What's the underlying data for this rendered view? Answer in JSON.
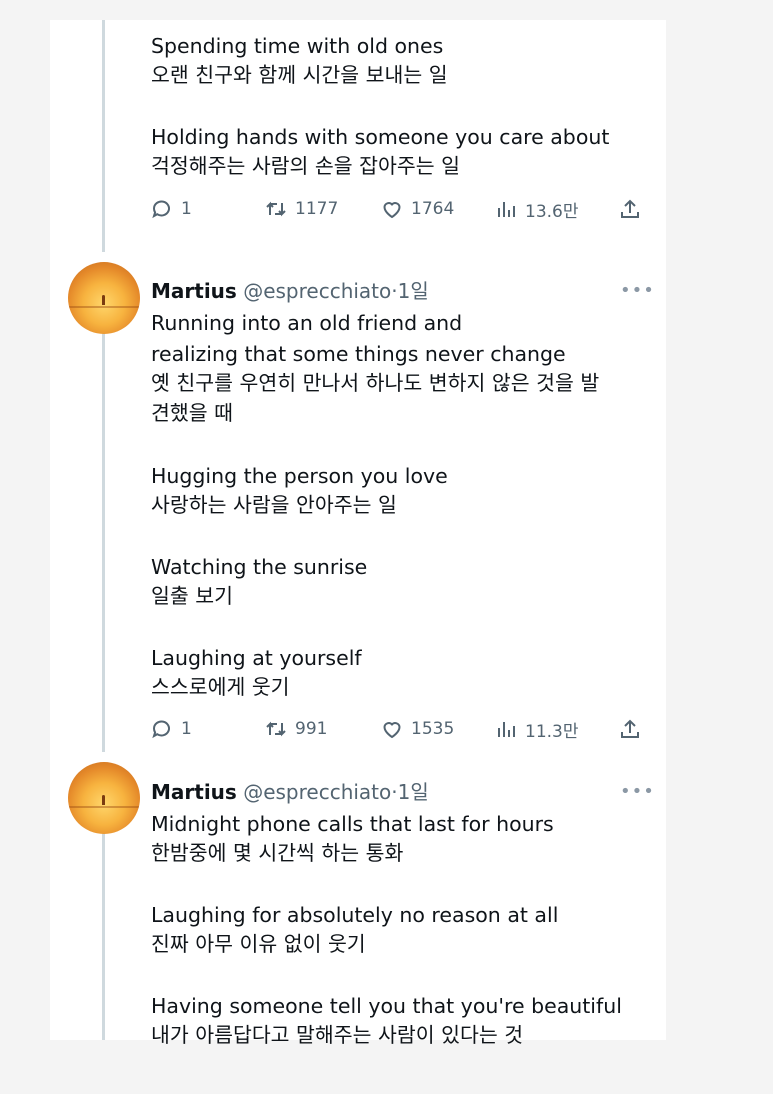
{
  "tweet0": {
    "lines": [
      "Spending time with old ones",
      "오랜 친구와 함께 시간을 보내는 일",
      "Holding hands with someone you care about",
      "걱정해주는 사람의 손을 잡아주는 일"
    ],
    "actions": {
      "replies": "1",
      "retweets": "1177",
      "likes": "1764",
      "views": "13.6만"
    }
  },
  "tweet1": {
    "author": {
      "name": "Martius",
      "handle": "@esprecchiato",
      "separator": "·",
      "time": "1일"
    },
    "more_icon": "more-dots-icon",
    "lines": [
      "Running into an old friend and",
      "realizing that some things never change",
      "옛 친구를 우연히 만나서 하나도 변하지 않은 것을 발",
      "견했을 때",
      "Hugging the person you love",
      "사랑하는 사람을 안아주는 일",
      "Watching the sunrise",
      "일출 보기",
      "Laughing at yourself",
      "스스로에게 웃기"
    ],
    "actions": {
      "replies": "1",
      "retweets": "991",
      "likes": "1535",
      "views": "11.3만"
    }
  },
  "tweet2": {
    "author": {
      "name": "Martius",
      "handle": "@esprecchiato",
      "separator": "·",
      "time": "1일"
    },
    "more_icon": "more-dots-icon",
    "lines": [
      "Midnight phone calls that last for hours",
      "한밤중에 몇 시간씩 하는 통화",
      "Laughing for absolutely no reason at all",
      "진짜 아무 이유 없이 웃기",
      "Having someone tell you that you're beautiful",
      "내가 아름답다고 말해주는 사람이 있다는 것"
    ]
  },
  "icons": {
    "reply": "speech-bubble-icon",
    "retweet": "retweet-arrows-icon",
    "like": "heart-icon",
    "views": "bar-chart-icon",
    "share": "share-upload-icon"
  },
  "colors": {
    "text": "#0f1419",
    "muted": "#536471",
    "thread_line": "#cfd9de"
  }
}
